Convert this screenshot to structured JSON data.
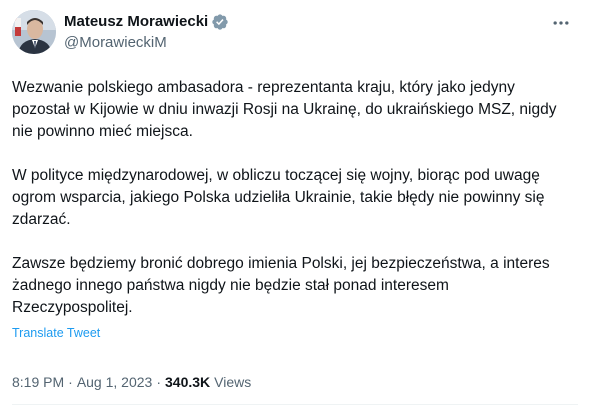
{
  "author": {
    "display_name": "Mateusz Morawiecki",
    "handle": "@MorawieckiM",
    "verified_color": "#829aab"
  },
  "tweet": {
    "paragraphs": [
      "Wezwanie polskiego ambasadora - reprezentanta kraju, który jako jedyny pozostał w Kijowie w dniu inwazji Rosji na Ukrainę, do ukraińskiego MSZ, nigdy nie powinno mieć miejsca.",
      "W polityce międzynarodowej, w obliczu toczącej się wojny, biorąc pod uwagę ogrom wsparcia, jakiego Polska udzieliła Ukrainie, takie błędy nie powinny się zdarzać.",
      "Zawsze będziemy bronić dobrego imienia Polski, jej bezpieczeństwa, a interes żadnego innego państwa nigdy nie będzie stał ponad interesem Rzeczypospolitej."
    ],
    "translate_label": "Translate Tweet"
  },
  "meta": {
    "time": "8:19 PM",
    "separator": "·",
    "date": "Aug 1, 2023",
    "views_count": "340.3K",
    "views_label": "Views"
  },
  "icons": {
    "more": "more-horizontal-icon",
    "verified": "verified-badge-icon"
  },
  "colors": {
    "link": "#1d9bf0",
    "secondary_text": "#536471",
    "primary_text": "#0f1419"
  }
}
